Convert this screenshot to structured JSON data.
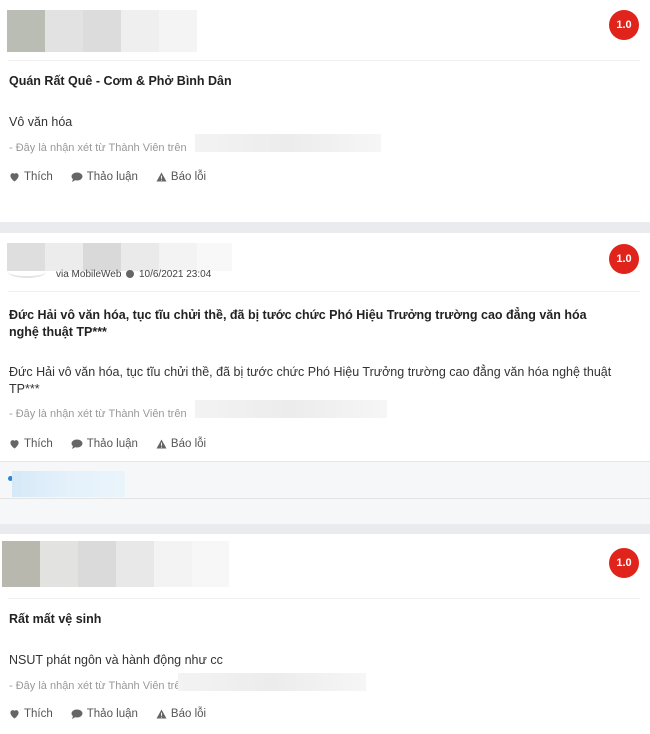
{
  "actions": {
    "like": "Thích",
    "discuss": "Thảo luận",
    "report": "Báo lỗi"
  },
  "source_prefix": "- Đây là nhận xét từ Thành Viên trên",
  "reviews": [
    {
      "score": "1.0",
      "title": "Quán Rất Quê - Cơm & Phở Bình Dân",
      "body": "Vô văn hóa"
    },
    {
      "score": "1.0",
      "via": "via MobileWeb",
      "date": "10/6/2021 23:04",
      "title": "Đức Hải vô văn hóa, tục tĩu chửi thề, đã bị tước chức Phó Hiệu Trưởng trường cao đẳng văn hóa nghệ thuật TP***",
      "body": "Đức Hải vô văn hóa, tục tĩu chửi thề, đã bị tước chức Phó Hiệu Trưởng trường cao đẳng văn hóa nghệ thuật TP***"
    },
    {
      "score": "1.0",
      "title": "Rất mất vệ sinh",
      "body": "NSUT phát ngôn và hành động như cc"
    }
  ],
  "colors": {
    "score_bg": "#e0231b",
    "separator": "#e9ebee"
  }
}
